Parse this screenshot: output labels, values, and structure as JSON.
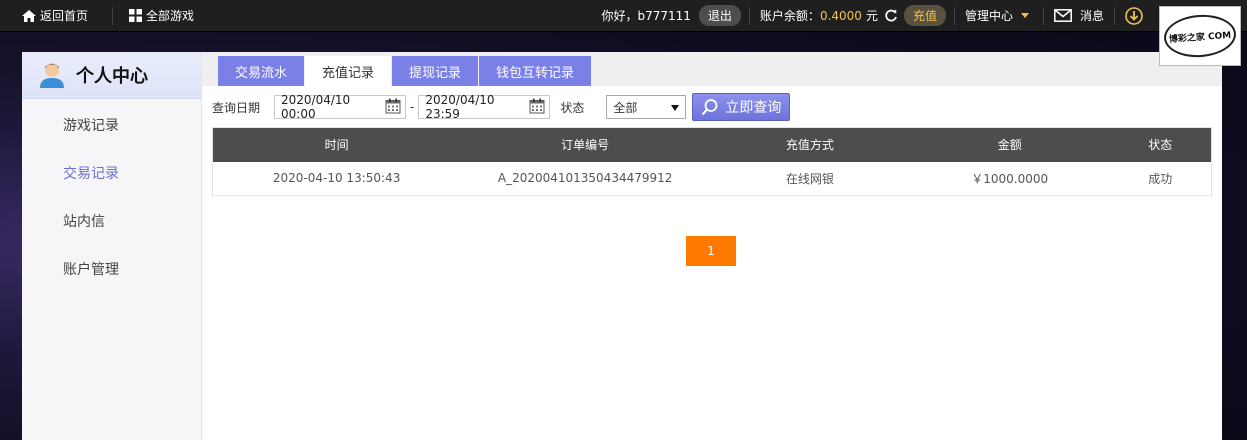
{
  "topbar": {
    "home_label": "返回首页",
    "all_games_label": "全部游戏",
    "greeting": "你好，b777111",
    "logout_label": "退出",
    "balance_label": "账户余额：",
    "balance_value": "0.4000",
    "currency": "元",
    "recharge_label": "充值",
    "manage_label": "管理中心",
    "messages_label": "消息",
    "logo_text": "博彩之家 COM"
  },
  "sidebar": {
    "title": "个人中心",
    "items": [
      {
        "label": "游戏记录",
        "active": false
      },
      {
        "label": "交易记录",
        "active": true
      },
      {
        "label": "站内信",
        "active": false
      },
      {
        "label": "账户管理",
        "active": false
      }
    ]
  },
  "tabs": [
    {
      "label": "交易流水",
      "active": false
    },
    {
      "label": "充值记录",
      "active": true
    },
    {
      "label": "提现记录",
      "active": false
    },
    {
      "label": "钱包互转记录",
      "active": false
    }
  ],
  "query": {
    "date_label": "查询日期",
    "start_date": "2020/04/10 00:00",
    "end_date": "2020/04/10 23:59",
    "separator": "-",
    "status_label": "状态",
    "status_selected": "全部",
    "search_button": "立即查询"
  },
  "table": {
    "headers": [
      "时间",
      "订单编号",
      "充值方式",
      "金额",
      "状态"
    ],
    "rows": [
      [
        "2020-04-10 13:50:43",
        "A_202004101350434479912",
        "在线网银",
        "￥1000.0000",
        "成功"
      ]
    ]
  },
  "pagination": {
    "current_page": "1"
  },
  "colors": {
    "accent": "#7b80e6",
    "gold": "#f2c14b",
    "pager": "#ff7a00",
    "table_header": "#4d4d4d"
  }
}
